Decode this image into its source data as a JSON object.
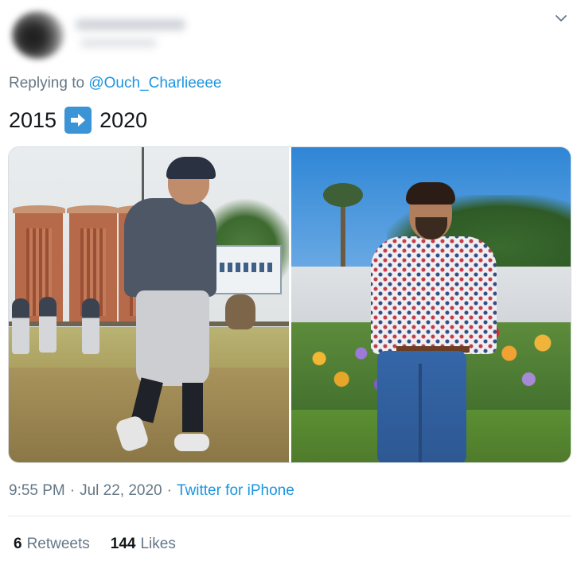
{
  "reply": {
    "prefix": "Replying to",
    "mention": "@Ouch_Charlieeee"
  },
  "tweet": {
    "year_from": "2015",
    "year_to": "2020",
    "emoji": "right-arrow-emoji"
  },
  "meta": {
    "time": "9:55 PM",
    "separator": "·",
    "date": "Jul 22, 2020",
    "separator2": "·",
    "source": "Twitter for iPhone"
  },
  "stats": {
    "retweets_count": "6",
    "retweets_label": "Retweets",
    "likes_count": "144",
    "likes_label": "Likes"
  },
  "colors": {
    "link": "#1b95e0",
    "secondary_text": "#657786",
    "primary_text": "#14171a",
    "emoji_bg": "#3a94d6"
  },
  "icons": {
    "caret": "chevron-down-icon",
    "arrow": "right-arrow-icon"
  }
}
